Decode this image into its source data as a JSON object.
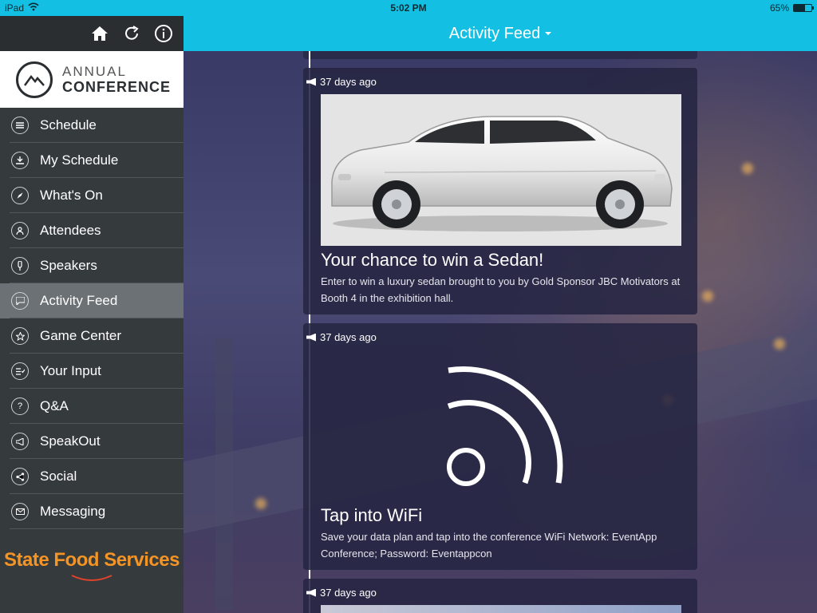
{
  "status_bar": {
    "device": "iPad",
    "time": "5:02 PM",
    "battery_text": "65%",
    "battery_level": 0.65
  },
  "sidebar": {
    "toolbar": {
      "home_icon": "home-icon",
      "refresh_icon": "refresh-icon",
      "info_icon": "info-icon"
    },
    "logo": {
      "line1": "ANNUAL",
      "line2": "CONFERENCE"
    },
    "items": [
      {
        "label": "Schedule",
        "icon": "list-icon"
      },
      {
        "label": "My Schedule",
        "icon": "download-icon"
      },
      {
        "label": "What's On",
        "icon": "compass-icon"
      },
      {
        "label": "Attendees",
        "icon": "person-icon"
      },
      {
        "label": "Speakers",
        "icon": "microphone-icon"
      },
      {
        "label": "Activity Feed",
        "icon": "chat-icon",
        "active": true
      },
      {
        "label": "Game Center",
        "icon": "star-icon"
      },
      {
        "label": "Your Input",
        "icon": "checklist-icon"
      },
      {
        "label": "Q&A",
        "icon": "question-icon"
      },
      {
        "label": "SpeakOut",
        "icon": "megaphone-icon"
      },
      {
        "label": "Social",
        "icon": "share-icon"
      },
      {
        "label": "Messaging",
        "icon": "mail-icon"
      }
    ],
    "sponsor": "State Food Services"
  },
  "header": {
    "title": "Activity Feed"
  },
  "feed": {
    "posts": [
      {
        "time": "37 days ago",
        "headline": "Your chance to win a Sedan!",
        "description": "Enter to win a luxury sedan brought to you by Gold Sponsor JBC Motivators at Booth 4 in the exhibition hall.",
        "media": "sedan-car-image"
      },
      {
        "time": "37 days ago",
        "headline": "Tap into WiFi",
        "description": "Save your data plan and tap into the conference WiFi Network: EventApp Conference; Password: Eventappcon",
        "media": "wifi-icon"
      },
      {
        "time": "37 days ago"
      }
    ]
  },
  "colors": {
    "accent": "#13c0e3",
    "sidebar_bg": "#353a3d",
    "sponsor_orange": "#f39424"
  }
}
